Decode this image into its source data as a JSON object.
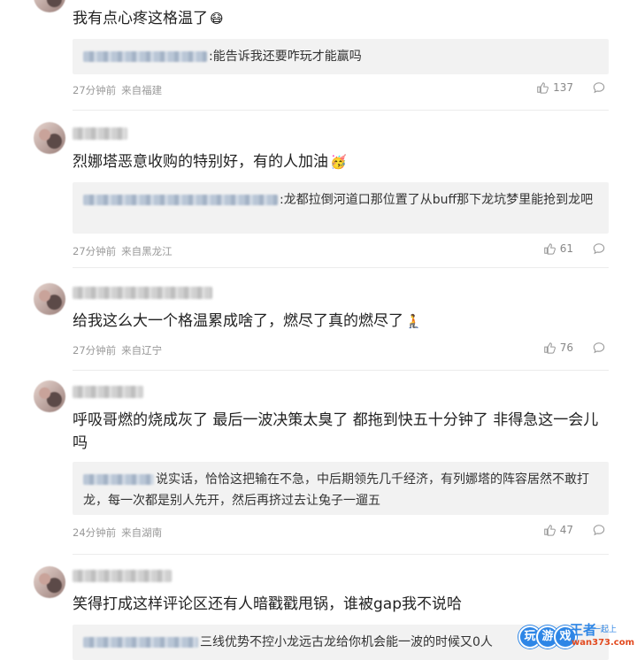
{
  "comments": [
    {
      "text": "我有点心疼这格温了",
      "emoji": "😷",
      "reply": {
        "text": ":能告诉我还要咋玩才能赢吗"
      },
      "time": "27分钟前",
      "source": "来自福建",
      "likes": "137"
    },
    {
      "text": "烈娜塔恶意收购的特别好，有的人加油",
      "emoji": "🥳",
      "reply": {
        "text": ":龙都拉倒河道口那位置了从buff那下龙坑梦里能抢到龙吧"
      },
      "time": "27分钟前",
      "source": "来自黑龙江",
      "likes": "61"
    },
    {
      "text": "给我这么大一个格温累成啥了，燃尽了真的燃尽了",
      "emoji": "🧎",
      "time": "27分钟前",
      "source": "来自辽宁",
      "likes": "76"
    },
    {
      "text": "呼吸哥燃的烧成灰了 最后一波决策太臭了 都拖到快五十分钟了 非得急这一会儿吗",
      "reply": {
        "text": "说实话，恰恰这把输在不急，中后期领先几千经济，有列娜塔的阵容居然不敢打龙，每一次都是别人先开，然后再挤过去让兔子一遛五"
      },
      "time": "24分钟前",
      "source": "来自湖南",
      "likes": "47"
    },
    {
      "text": "笑得打成这样评论区还有人暗戳戳甩锅，谁被gap我不说哈",
      "reply": {
        "text": "三线优势不控小龙远古龙给你机会能一波的时候又0人"
      }
    }
  ],
  "watermark": {
    "brand": "王者",
    "slogan": "一起上",
    "url": "wan373.com",
    "circle_letters": [
      "玩",
      "游",
      "戏"
    ]
  },
  "icons": {
    "like": "thumbs-up-icon",
    "reply": "comment-bubble-icon"
  }
}
